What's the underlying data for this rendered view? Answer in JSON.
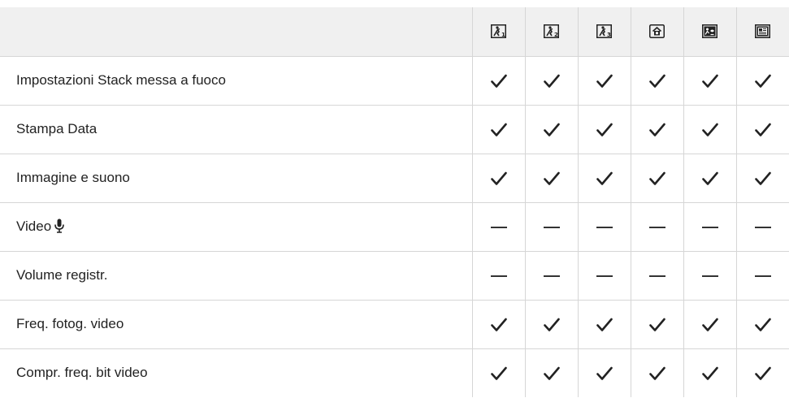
{
  "table": {
    "header_modes": [
      {
        "icon": "custom-mode-1-icon",
        "subscript": "1"
      },
      {
        "icon": "custom-mode-2-icon",
        "subscript": "2"
      },
      {
        "icon": "custom-mode-3-icon",
        "subscript": "3"
      },
      {
        "icon": "home-mode-icon"
      },
      {
        "icon": "scene-mode-icon"
      },
      {
        "icon": "art-mode-icon"
      }
    ],
    "rows": [
      {
        "label": "Impostazioni Stack messa a fuoco",
        "values": [
          "check",
          "check",
          "check",
          "check",
          "check",
          "check"
        ]
      },
      {
        "label": "Stampa Data",
        "values": [
          "check",
          "check",
          "check",
          "check",
          "check",
          "check"
        ]
      },
      {
        "label": "Immagine e suono",
        "values": [
          "check",
          "check",
          "check",
          "check",
          "check",
          "check"
        ]
      },
      {
        "label": "Video",
        "icon": "microphone-icon",
        "values": [
          "dash",
          "dash",
          "dash",
          "dash",
          "dash",
          "dash"
        ]
      },
      {
        "label": "Volume registr.",
        "values": [
          "dash",
          "dash",
          "dash",
          "dash",
          "dash",
          "dash"
        ]
      },
      {
        "label": "Freq. fotog. video",
        "values": [
          "check",
          "check",
          "check",
          "check",
          "check",
          "check"
        ]
      },
      {
        "label": "Compr. freq. bit video",
        "values": [
          "check",
          "check",
          "check",
          "check",
          "check",
          "check"
        ]
      }
    ]
  }
}
